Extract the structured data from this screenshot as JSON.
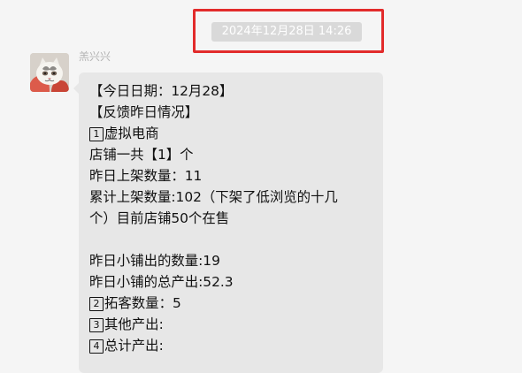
{
  "timestamp": "2024年12月28日 14:26",
  "sender": {
    "name": "羔兴兴"
  },
  "message": {
    "lines": [
      {
        "text": "【今日日期：12月28】"
      },
      {
        "text": "【反馈昨日情况】"
      },
      {
        "text": "虚拟电商",
        "badge": "1"
      },
      {
        "text": "店铺一共【1】个"
      },
      {
        "text": "昨日上架数量：11"
      },
      {
        "text": "累计上架数量:102（下架了低浏览的十几"
      },
      {
        "text": "个）目前店铺50个在售"
      },
      {
        "text": ""
      },
      {
        "text": "昨日小铺出的数量:19"
      },
      {
        "text": "昨日小铺的总产出:52.3"
      },
      {
        "text": "拓客数量：5",
        "badge": "2"
      },
      {
        "text": "其他产出:",
        "badge": "3"
      },
      {
        "text": "总计产出:",
        "badge": "4"
      }
    ]
  },
  "colors": {
    "page_background": "#f5f5f5",
    "bubble_background": "#e7e7e7",
    "timestamp_pill": "#d9d9d9",
    "highlight_border": "#e22b2b",
    "sender_name": "#b3b3b3"
  },
  "icons": {
    "avatar": "cat-avatar-icon"
  }
}
